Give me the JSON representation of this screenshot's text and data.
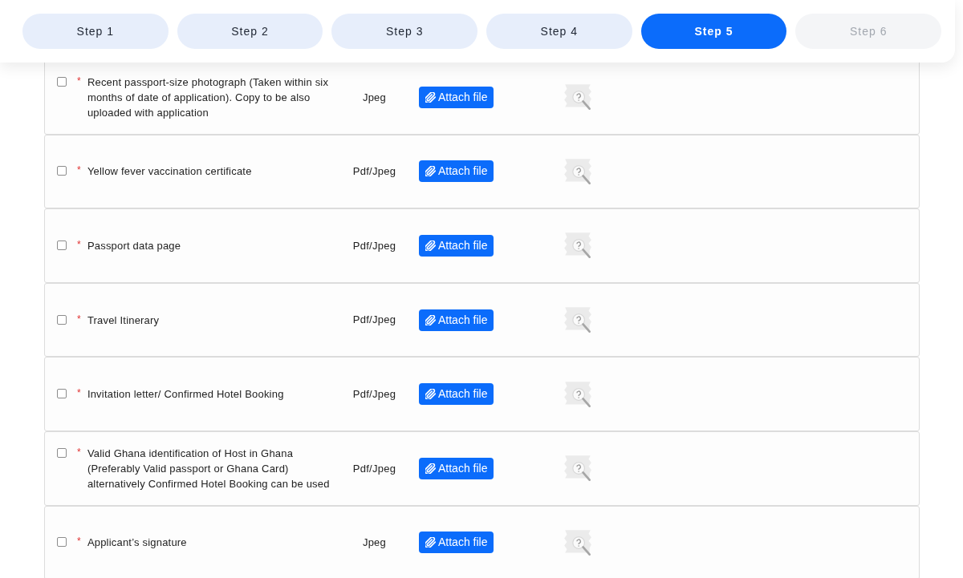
{
  "steps": [
    {
      "label": "Step 1",
      "selected": false,
      "disabled": false
    },
    {
      "label": "Step 2",
      "selected": false,
      "disabled": false
    },
    {
      "label": "Step 3",
      "selected": false,
      "disabled": false
    },
    {
      "label": "Step 4",
      "selected": false,
      "disabled": false
    },
    {
      "label": "Step 5",
      "selected": true,
      "disabled": false
    },
    {
      "label": "Step 6",
      "selected": false,
      "disabled": true
    }
  ],
  "documents": [
    {
      "checked": false,
      "required_mark": "*",
      "description": "Recent passport-size photograph (Taken within six months of date of application). Copy to be also uploaded with application",
      "file_type": "Jpeg",
      "button": "Attach file"
    },
    {
      "checked": false,
      "required_mark": "*",
      "description": "Yellow fever vaccination certificate",
      "file_type": "Pdf/Jpeg",
      "button": "Attach file"
    },
    {
      "checked": false,
      "required_mark": "*",
      "description": "Passport data page",
      "file_type": "Pdf/Jpeg",
      "button": "Attach file"
    },
    {
      "checked": false,
      "required_mark": "*",
      "description": "Travel Itinerary",
      "file_type": "Pdf/Jpeg",
      "button": "Attach file"
    },
    {
      "checked": false,
      "required_mark": "*",
      "description": "Invitation letter/ Confirmed Hotel Booking",
      "file_type": "Pdf/Jpeg",
      "button": "Attach file"
    },
    {
      "checked": false,
      "required_mark": "*",
      "description": "Valid Ghana identification of Host in Ghana (Preferably Valid passport or Ghana Card) alternatively Confirmed Hotel Booking can be used",
      "file_type": "Pdf/Jpeg",
      "button": "Attach file"
    },
    {
      "checked": false,
      "required_mark": "*",
      "description": "Applicant’s signature",
      "file_type": "Jpeg",
      "button": "Attach file"
    }
  ]
}
